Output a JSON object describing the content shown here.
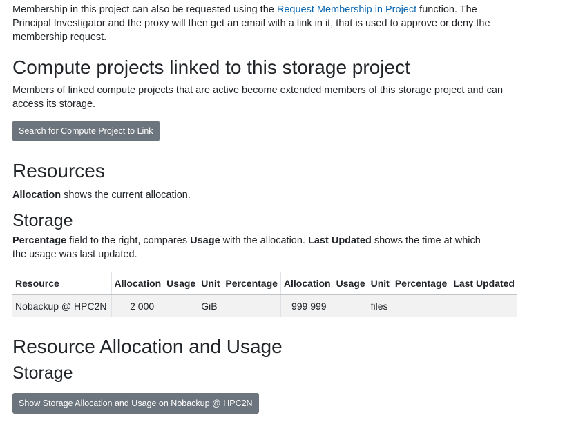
{
  "intro": {
    "text_before": "Membership in this project can also be requested using the ",
    "link": "Request Membership in Project",
    "text_after": " function. The Principal Investigator and the proxy will then get an email with a link in it, that is used to approve or deny the membership request."
  },
  "compute": {
    "heading": "Compute projects linked to this storage project",
    "description": "Members of linked compute projects that are active become extended members of this storage project and can access its storage.",
    "button": "Search for Compute Project to Link"
  },
  "resources": {
    "heading": "Resources",
    "allocation_bold": "Allocation",
    "allocation_text": " shows the current allocation."
  },
  "storage": {
    "heading": "Storage",
    "pct_bold": "Percentage",
    "text1": " field to the right, compares ",
    "usage_bold": "Usage",
    "text2": " with the allocation. ",
    "lu_bold": "Last Updated",
    "text3": " shows the time at which the usage was last updated."
  },
  "table": {
    "headers": [
      "Resource",
      "Allocation",
      "Usage",
      "Unit",
      "Percentage",
      "Allocation",
      "Usage",
      "Unit",
      "Percentage",
      "Last Updated"
    ],
    "rows": [
      [
        "Nobackup @ HPC2N",
        "2 000",
        "",
        "GiB",
        "",
        "999 999",
        "",
        "files",
        "",
        ""
      ]
    ]
  },
  "allocation_usage": {
    "heading": "Resource Allocation and Usage",
    "sub_heading": "Storage",
    "button": "Show Storage Allocation and Usage on Nobackup @ HPC2N"
  }
}
